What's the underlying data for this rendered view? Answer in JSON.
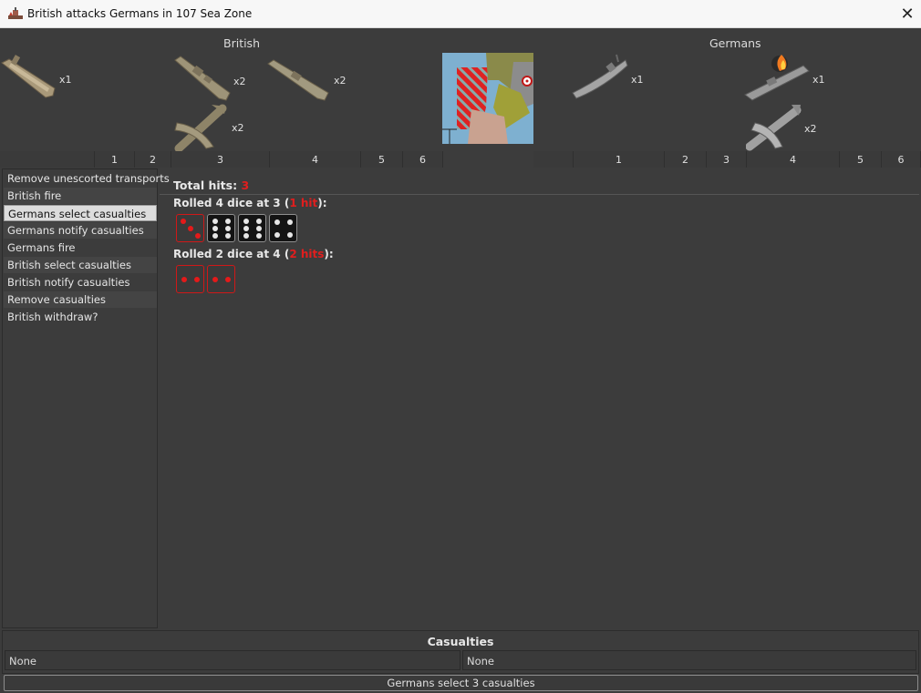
{
  "window": {
    "title": "British attacks Germans in 107 Sea Zone",
    "app_icon": "battle-icon",
    "close_glyph": "✕"
  },
  "attacker": {
    "name": "British",
    "units": [
      {
        "name": "transport",
        "count": "x1"
      },
      {
        "name": "battleship",
        "count": "x2"
      },
      {
        "name": "cruiser",
        "count": "x2"
      },
      {
        "name": "fighter",
        "count": "x2"
      }
    ],
    "columns": [
      "1",
      "2",
      "3",
      "4",
      "5",
      "6"
    ]
  },
  "defender": {
    "name": "Germans",
    "units": [
      {
        "name": "submarine",
        "count": "x1"
      },
      {
        "name": "damaged-battleship",
        "count": "x1"
      },
      {
        "name": "fighter",
        "count": "x2"
      }
    ],
    "columns": [
      "1",
      "2",
      "3",
      "4",
      "5",
      "6"
    ]
  },
  "steps": [
    "Remove unescorted transports",
    "British fire",
    "Germans select casualties",
    "Germans notify casualties",
    "Germans fire",
    "British select casualties",
    "British notify casualties",
    "Remove casualties",
    "British withdraw?"
  ],
  "selected_step": 2,
  "results": {
    "total_label": "Total hits: ",
    "total_value": "3",
    "rolls": [
      {
        "prefix": "Rolled 4 dice at 3 (",
        "hits": "1 hit",
        "suffix": "):",
        "dice": [
          {
            "value": 3,
            "hit": true
          },
          {
            "value": 6,
            "hit": false
          },
          {
            "value": 6,
            "hit": false
          },
          {
            "value": 4,
            "hit": false
          }
        ]
      },
      {
        "prefix": "Rolled 2 dice at 4 (",
        "hits": "2 hits",
        "suffix": "):",
        "dice": [
          {
            "value": 2,
            "hit": true
          },
          {
            "value": 2,
            "hit": true
          }
        ]
      }
    ]
  },
  "casualties": {
    "title": "Casualties",
    "attacker": "None",
    "defender": "None"
  },
  "status_button": "Germans select 3 casualties",
  "colors": {
    "hit": "#e01e1e",
    "background": "#3c3c3c"
  }
}
